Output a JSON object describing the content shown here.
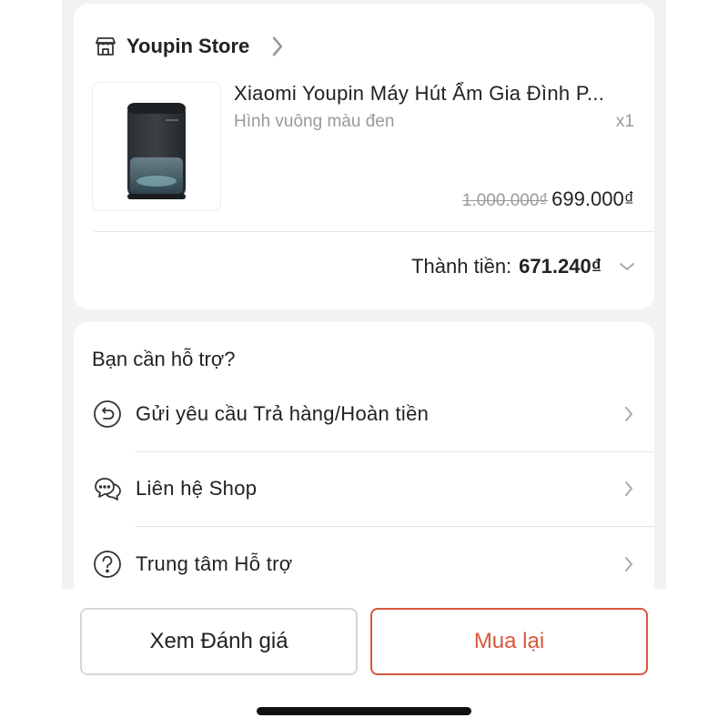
{
  "store": {
    "name": "Youpin Store",
    "icon": "store-icon"
  },
  "product": {
    "title": "Xiaomi Youpin Máy Hút Ẩm Gia Đình P...",
    "variant": "Hình vuông màu đen",
    "quantity": "x1",
    "original_price": "1.000.000₫",
    "price": "699.000₫"
  },
  "total": {
    "label": "Thành tiền:",
    "value": "671.240₫"
  },
  "help": {
    "title": "Bạn cần hỗ trợ?",
    "items": [
      {
        "label": "Gửi yêu cầu Trả hàng/Hoàn tiền",
        "icon": "return-refund-icon"
      },
      {
        "label": "Liên hệ Shop",
        "icon": "chat-icon"
      },
      {
        "label": "Trung tâm Hỗ trợ",
        "icon": "question-icon"
      }
    ]
  },
  "actions": {
    "review_label": "Xem Đánh giá",
    "rebuy_label": "Mua lại"
  },
  "colors": {
    "accent": "#d9573b",
    "background": "#f2f2f2"
  }
}
